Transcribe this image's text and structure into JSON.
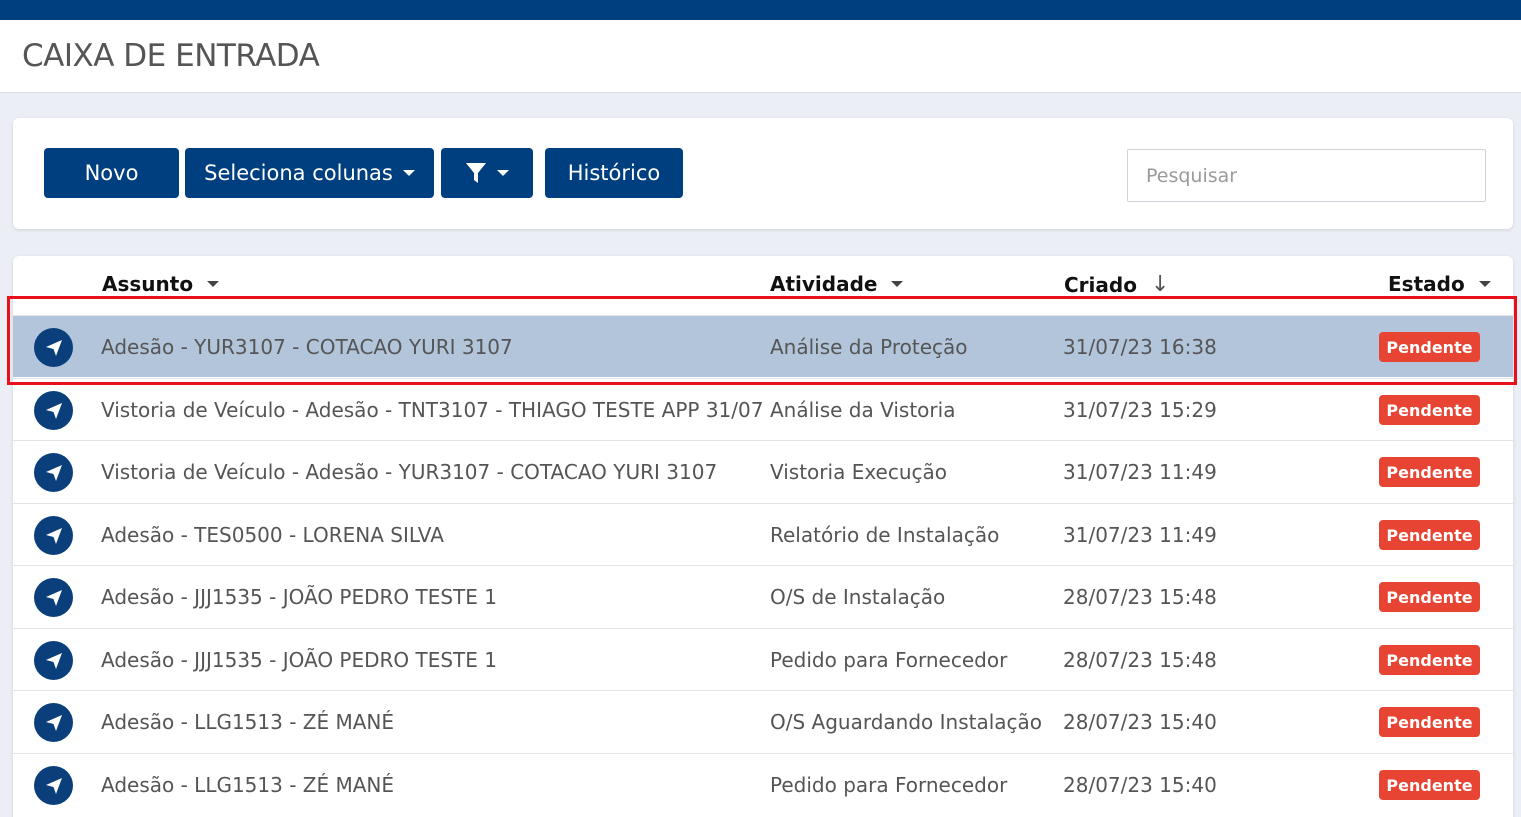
{
  "header": {
    "title": "CAIXA DE ENTRADA"
  },
  "toolbar": {
    "new_label": "Novo",
    "columns_label": "Seleciona colunas",
    "history_label": "Histórico",
    "search_placeholder": "Pesquisar"
  },
  "table": {
    "columns": {
      "subject": "Assunto",
      "activity": "Atividade",
      "created": "Criado",
      "status": "Estado"
    },
    "rows": [
      {
        "subject": "Adesão - YUR3107 - COTACAO YURI 3107",
        "activity": "Análise da Proteção",
        "created": "31/07/23 16:38",
        "status": "Pendente",
        "selected": true
      },
      {
        "subject": "Vistoria de Veículo - Adesão - TNT3107 - THIAGO TESTE APP 31/07",
        "activity": "Análise da Vistoria",
        "created": "31/07/23 15:29",
        "status": "Pendente"
      },
      {
        "subject": "Vistoria de Veículo - Adesão - YUR3107 - COTACAO YURI 3107",
        "activity": "Vistoria Execução",
        "created": "31/07/23 11:49",
        "status": "Pendente"
      },
      {
        "subject": "Adesão - TES0500 - LORENA SILVA",
        "activity": "Relatório de Instalação",
        "created": "31/07/23 11:49",
        "status": "Pendente"
      },
      {
        "subject": "Adesão - JJJ1535 - JOÃO PEDRO TESTE 1",
        "activity": "O/S de Instalação",
        "created": "28/07/23 15:48",
        "status": "Pendente"
      },
      {
        "subject": "Adesão - JJJ1535 - JOÃO PEDRO TESTE 1",
        "activity": "Pedido para Fornecedor",
        "created": "28/07/23 15:48",
        "status": "Pendente"
      },
      {
        "subject": "Adesão - LLG1513 - ZÉ MANÉ",
        "activity": "O/S Aguardando Instalação",
        "created": "28/07/23 15:40",
        "status": "Pendente"
      },
      {
        "subject": "Adesão - LLG1513 - ZÉ MANÉ",
        "activity": "Pedido para Fornecedor",
        "created": "28/07/23 15:40",
        "status": "Pendente"
      }
    ]
  },
  "colors": {
    "primary": "#003f7f",
    "selected_row": "#b3c5db",
    "badge_pending": "#e74433",
    "highlight_box": "#e8101b"
  },
  "icons": {
    "filter": "filter-icon",
    "row_icon": "send-icon"
  }
}
